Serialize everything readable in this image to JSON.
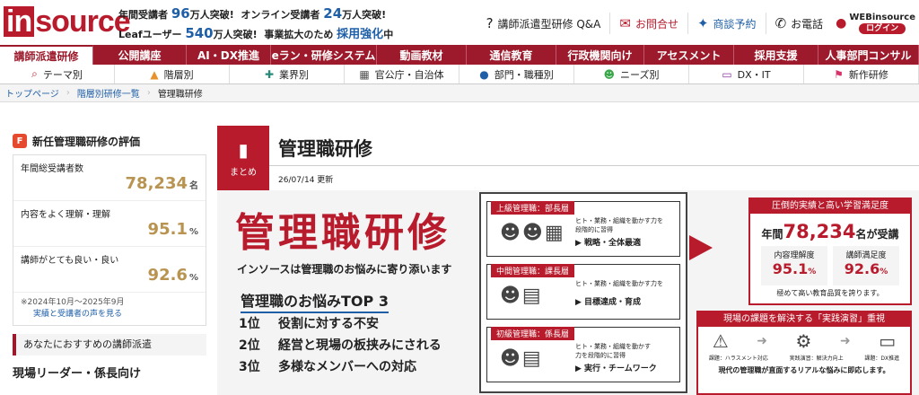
{
  "header": {
    "logo_in": "in",
    "logo_source": "source",
    "line1_a": "年間受講者",
    "line1_num": "96",
    "line1_b": "万人突破!",
    "line1_c": "オンライン受講者",
    "line1_num2": "24",
    "line1_d": "万人突破!",
    "line2_a": "Leafユーザー",
    "line2_num": "540",
    "line2_b": "万人突破!",
    "line2_c": "事業拡大のため",
    "line2_hl": "採用強化",
    "line2_d": "中",
    "links": {
      "qa": "講師派遣型研修 Q&A",
      "contact": "お問合せ",
      "consult": "商談予約",
      "phone": "お電話"
    },
    "login_brand": "WEBinsource",
    "login_label": "ログイン"
  },
  "nav": {
    "items": [
      "講師派遣研修",
      "公開講座",
      "AI・DX推進",
      "eラン・研修システム",
      "動画教材",
      "通信教育",
      "行政機関向け",
      "アセスメント",
      "採用支援",
      "人事部門コンサル"
    ]
  },
  "subnav": {
    "items": [
      "テーマ別",
      "階層別",
      "業界別",
      "官公庁・自治体",
      "部門・職種別",
      "ニーズ別",
      "DX・IT",
      "新作研修"
    ]
  },
  "breadcrumb": {
    "top": "トップページ",
    "mid": "階層別研修一覧",
    "current": "管理職研修"
  },
  "sidebar": {
    "title": "新任管理職研修の評価",
    "rows": [
      {
        "label": "年間総受講者数",
        "value": "78,234",
        "unit": "名"
      },
      {
        "label": "内容をよく理解・理解",
        "value": "95.1",
        "unit": "%"
      },
      {
        "label": "講師がとても良い・良い",
        "value": "92.6",
        "unit": "%"
      }
    ],
    "note": "※2024年10月～2025年9月",
    "note_link": "実績と受講者の声を見る",
    "rec_title": "あなたにおすすめの講師派遣",
    "rec_item": "現場リーダー・係長向け"
  },
  "main": {
    "summary": "まとめ",
    "title": "管理職研修",
    "date": "26/07/14 更新"
  },
  "banner": {
    "big": "管理職研修",
    "sub": "インソースは管理職のお悩みに寄り添います",
    "top_title": "管理職のお悩みTOP 3",
    "ranks": [
      {
        "rank": "1位",
        "text": "役割に対する不安"
      },
      {
        "rank": "2位",
        "text": "経営と現場の板挟みにされる"
      },
      {
        "rank": "3位",
        "text": "多様なメンバーへの対応"
      }
    ],
    "tiers": [
      {
        "label": "上級管理職：部長層",
        "desc1": "ヒト・業務・組織を動かす力を",
        "desc2": "段階的に習得",
        "point": "▶ 戦略・全体最適"
      },
      {
        "label": "中間管理職：課長層",
        "desc1": "ヒト・業務・組織を動かす力を",
        "desc2": "段階的に習得",
        "point": "▶ 目標達成・育成"
      },
      {
        "label": "初級管理職：係長層",
        "desc1": "ヒト・業務・組織を動かす",
        "desc2": "力を段階的に習得",
        "point": "▶ 実行・チームワーク"
      }
    ],
    "stats_title": "圧倒的実績と高い学習満足度",
    "stats_a": "年間",
    "stats_num": "78,234",
    "stats_b": "名が受講",
    "cell1_label": "内容理解度",
    "cell1_val": "95.1",
    "cell2_label": "講師満足度",
    "cell2_val": "92.6",
    "pct": "%",
    "stats_note": "極めて高い教育品質を誇ります。",
    "practice_title": "現場の課題を解決する「実践演習」重視",
    "practice_caps": [
      "課題：ハラスメント対応",
      "実践演習：解決力向上",
      "課題：DX推進"
    ],
    "practice_note": "現代の管理職が直面するリアルな悩みに即応します。"
  }
}
